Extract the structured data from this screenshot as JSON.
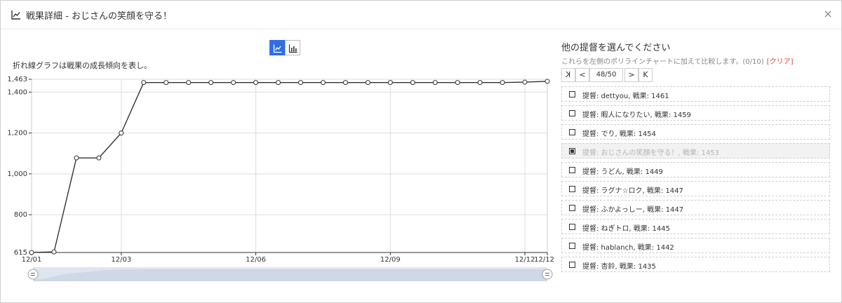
{
  "dialog": {
    "title": "戦果詳細 - おじさんの笑顔を守る！",
    "close_label": "×"
  },
  "chart_panel": {
    "description": "折れ線グラフは戦果の成長傾向を表し。",
    "toggle_active": "line"
  },
  "chart_data": {
    "type": "line",
    "title": "",
    "xlabel": "",
    "ylabel": "",
    "ylim": [
      615,
      1463
    ],
    "yticks": [
      "1,463",
      "1,400",
      "1,200",
      "1,000",
      "800",
      "615"
    ],
    "ytick_values": [
      1463,
      1400,
      1200,
      1000,
      800,
      615
    ],
    "xticks": [
      "12/01",
      "12/03",
      "12/06",
      "12/09",
      "12/12",
      "12/12"
    ],
    "xtick_values": [
      0,
      4,
      10,
      16,
      22,
      23
    ],
    "xlim": [
      0,
      23
    ],
    "series": [
      {
        "color": "#333333",
        "values": [
          615,
          618,
          1078,
          1078,
          1200,
          1447,
          1447,
          1447,
          1447,
          1447,
          1447,
          1447,
          1447,
          1447,
          1447,
          1447,
          1447,
          1447,
          1447,
          1447,
          1447,
          1447,
          1449,
          1453
        ]
      }
    ],
    "grid": true,
    "legend": "none"
  },
  "right_panel": {
    "title": "他の提督を選んでください",
    "subtitle": "これらを左側のポリラインチャートに加えて比較します。(0/10)",
    "clear_label": "[クリア]",
    "pager": {
      "first": "K",
      "prev": "<",
      "info": "48/50",
      "next": ">",
      "last": "K"
    },
    "items": [
      {
        "label": "提督: dettyou, 戦果: 1461",
        "checked": false,
        "disabled": false
      },
      {
        "label": "提督: 暇人になりたい, 戦果: 1459",
        "checked": false,
        "disabled": false
      },
      {
        "label": "提督: でり, 戦果: 1454",
        "checked": false,
        "disabled": false
      },
      {
        "label": "提督: おじさんの笑顔を守る！, 戦果: 1453",
        "checked": true,
        "disabled": true
      },
      {
        "label": "提督: うどん, 戦果: 1449",
        "checked": false,
        "disabled": false
      },
      {
        "label": "提督: ラグナ☆ロク, 戦果: 1447",
        "checked": false,
        "disabled": false
      },
      {
        "label": "提督: ふかよっしー, 戦果: 1447",
        "checked": false,
        "disabled": false
      },
      {
        "label": "提督: ねぎトロ, 戦果: 1445",
        "checked": false,
        "disabled": false
      },
      {
        "label": "提督: hablanch, 戦果: 1442",
        "checked": false,
        "disabled": false
      },
      {
        "label": "提督: 杏鈴, 戦果: 1435",
        "checked": false,
        "disabled": false
      }
    ]
  },
  "icons": {
    "title_icon": "line-chart-icon",
    "line_toggle_icon": "line-chart-icon",
    "bar_toggle_icon": "bar-chart-icon",
    "slider_handle_icon": "drag-handle-icon"
  },
  "colors": {
    "accent": "#2f6fe4",
    "clear_link": "#e0473c",
    "line": "#333333"
  }
}
